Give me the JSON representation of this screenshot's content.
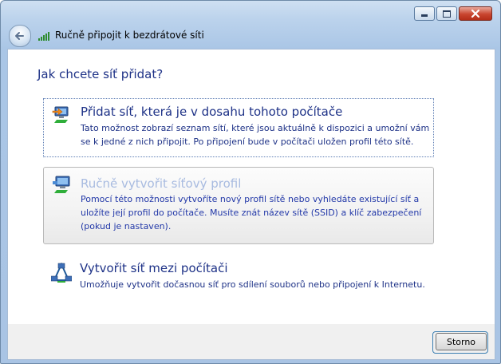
{
  "window": {
    "title": "Ručně připojit k bezdrátové síti"
  },
  "page": {
    "heading": "Jak chcete síť přidat?"
  },
  "options": [
    {
      "title": "Přidat síť, která je v dosahu tohoto počítače",
      "description": "Tato možnost zobrazí seznam sítí, které jsou aktuálně k dispozici a umožní vám se k jedné z nich připojit. Po připojení bude v počítači uložen profil této sítě."
    },
    {
      "title": "Ručně vytvořit síťový profil",
      "description": "Pomocí této možnosti vytvoříte nový profil sítě nebo vyhledáte existující síť a uložíte její profil do počítače. Musíte znát název sítě (SSID) a klíč zabezpečení (pokud je nastaven)."
    },
    {
      "title": "Vytvořit síť mezi počítači",
      "description": "Umožňuje vytvořit dočasnou síť pro sdílení souborů nebo připojení k Internetu."
    }
  ],
  "footer": {
    "cancel_label": "Storno"
  }
}
